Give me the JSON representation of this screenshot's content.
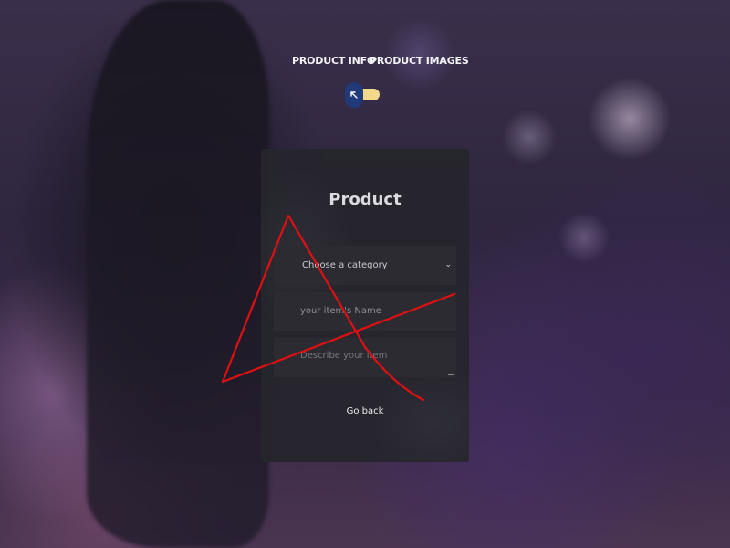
{
  "nav": {
    "product_info": "PRODUCT INFO",
    "product_images": "PRODUCT IMAGES"
  },
  "theme_toggle": {
    "icon": "arrow-up-left-icon",
    "state": "on",
    "knob_color": "#213a7a",
    "track_color": "#f1d88a"
  },
  "form": {
    "title": "Product",
    "category_selected": "Choose a category",
    "name_placeholder": "your item's Name",
    "description_placeholder": "Describe your item",
    "go_back_label": "Go back"
  },
  "colors": {
    "card_bg": "#26262c",
    "field_bg": "#2b2b31",
    "scribble": "#e01010"
  }
}
